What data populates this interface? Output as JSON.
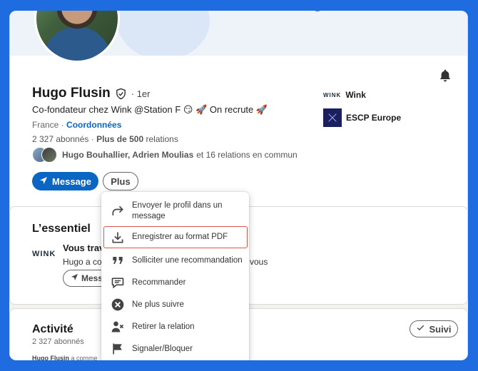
{
  "profile": {
    "name": "Hugo Flusin",
    "degree": "· 1er",
    "headline": "Co-fondateur chez Wink @Station F 😏 🚀 On recrute 🚀",
    "country": "France",
    "location_sep": "·",
    "contact_link": "Coordonnées",
    "followers": "2 327 abonnés",
    "stats_sep": "·",
    "connections_bold": "Plus de 500",
    "connections_rest": "relations",
    "mutual_names": "Hugo Bouhallier, Adrien Moulias",
    "mutual_rest": "et 16 relations en commun",
    "message_label": "Message",
    "plus_label": "Plus"
  },
  "companies": [
    {
      "logo": "WINK",
      "name": "Wink"
    },
    {
      "logo": "escp-logo",
      "name": "ESCP Europe"
    }
  ],
  "essentiel": {
    "title": "L’essentiel",
    "logo": "WINK",
    "role": "Vous trav",
    "desc": "Hugo a co",
    "desc_tail": "vous",
    "button_label": "Mess"
  },
  "activite": {
    "title": "Activité",
    "followers": "2 327 abonnés",
    "post_author": "Hugo Flusin",
    "post_rest": "a comme",
    "follow_label": "Suivi"
  },
  "dropdown": {
    "items": [
      {
        "label": "Envoyer le profil dans un message",
        "icon": "share-arrow-icon"
      },
      {
        "label": "Enregistrer au format PDF",
        "icon": "download-icon"
      },
      {
        "label": "Solliciter une recommandation",
        "icon": "quote-icon"
      },
      {
        "label": "Recommander",
        "icon": "comment-icon"
      },
      {
        "label": "Ne plus suivre",
        "icon": "unfollow-x-icon"
      },
      {
        "label": "Retirer la relation",
        "icon": "remove-person-icon"
      },
      {
        "label": "Signaler/Bloquer",
        "icon": "flag-icon"
      }
    ]
  },
  "colors": {
    "background": "#1e6ce0",
    "primary": "#0a66c2",
    "highlight": "#d9534f"
  }
}
